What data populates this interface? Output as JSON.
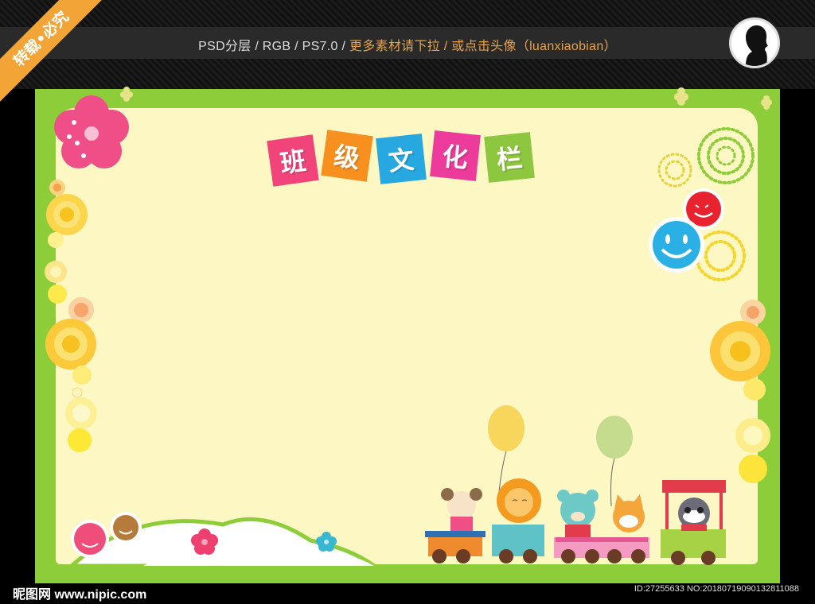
{
  "header": {
    "info_prefix": "PSD分层 / RGB / PS7.0 / ",
    "info_highlight": "更多素材请下拉 / 或点击头像（luanxiaobian）",
    "ribbon_text": "转载•必究"
  },
  "board": {
    "title_chars": [
      "班",
      "级",
      "文",
      "化",
      "栏"
    ],
    "title_colors": [
      "#f0447a",
      "#f7901e",
      "#27a8e0",
      "#ec3b9b",
      "#8dc63f"
    ]
  },
  "footer": {
    "site": "昵图网 www.nipic.com",
    "id_text": "ID:27255633 NO:20180719090132811088"
  },
  "colors": {
    "border_green": "#8dcd3a",
    "board_fill": "#fdf7c3",
    "accent_orange": "#f2a436"
  }
}
